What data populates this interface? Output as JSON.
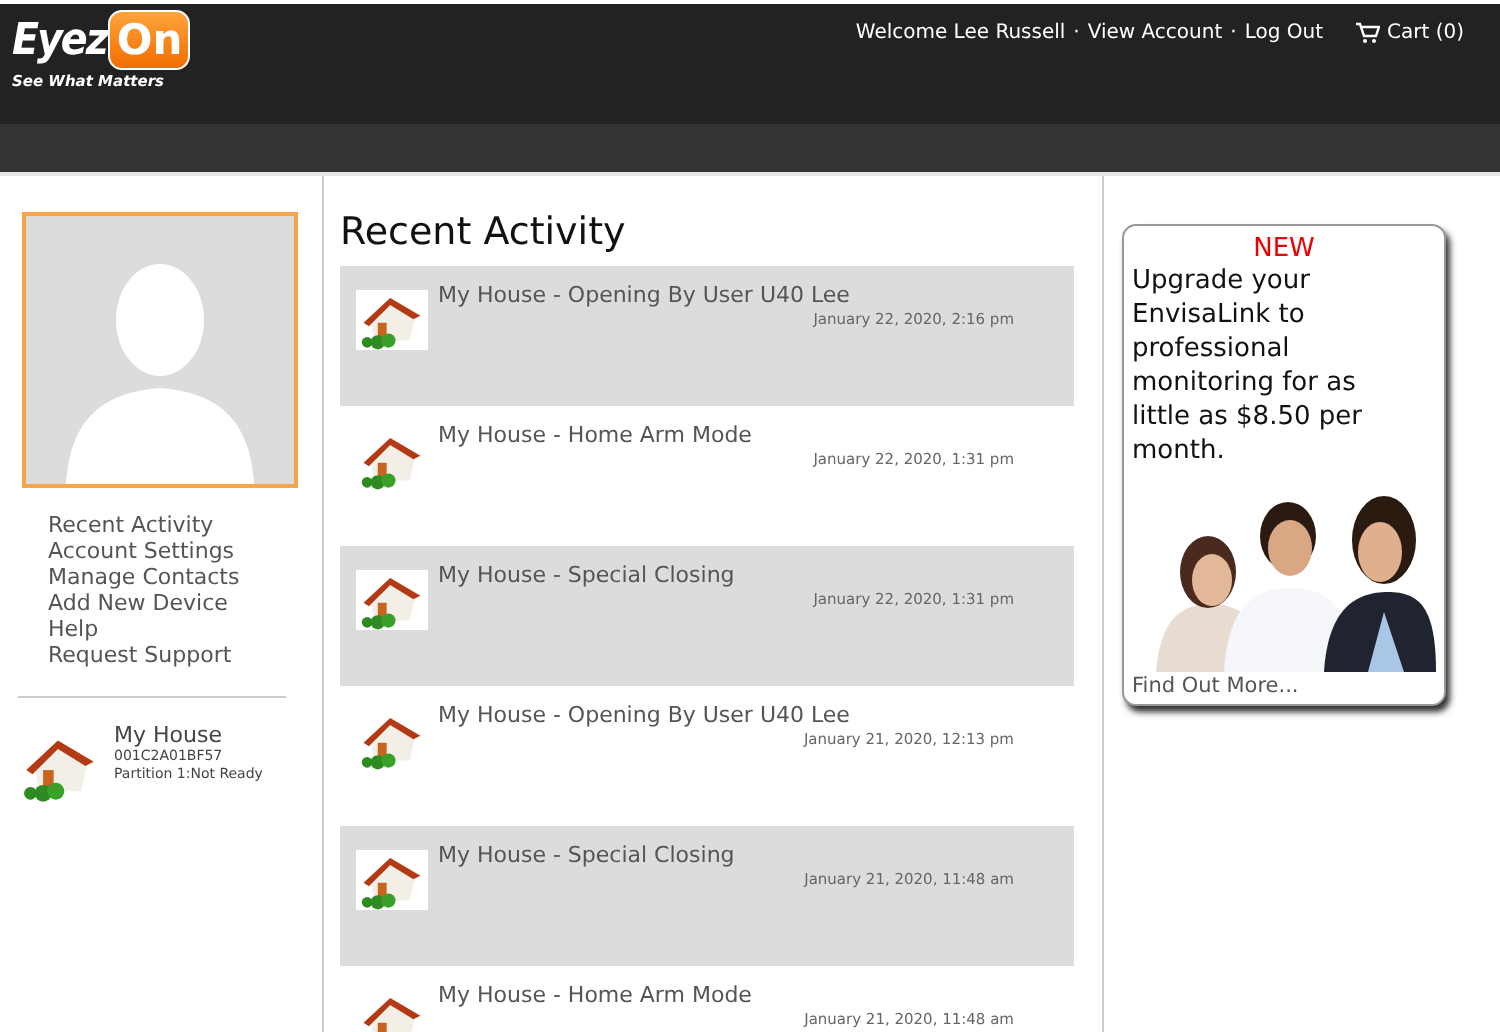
{
  "header": {
    "logo": {
      "word": "Eyez",
      "badge": "On",
      "tagline": "See What Matters"
    },
    "welcome": "Welcome Lee Russell",
    "links": [
      "View Account",
      "Log Out"
    ],
    "separator": "·",
    "cart": "Cart (0)"
  },
  "sidebar": {
    "items": [
      "Recent Activity",
      "Account Settings",
      "Manage Contacts",
      "Add New Device",
      "Help",
      "Request Support"
    ],
    "device": {
      "name": "My House",
      "id": "001C2A01BF57",
      "status": "Partition 1:Not Ready"
    }
  },
  "activity": {
    "title": "Recent Activity",
    "events": [
      {
        "text": "My House - Opening By User U40 Lee",
        "time": "January 22, 2020, 2:16 pm"
      },
      {
        "text": "My House - Home Arm Mode",
        "time": "January 22, 2020, 1:31 pm"
      },
      {
        "text": "My House - Special Closing",
        "time": "January 22, 2020, 1:31 pm"
      },
      {
        "text": "My House - Opening By User U40 Lee",
        "time": "January 21, 2020, 12:13 pm"
      },
      {
        "text": "My House - Special Closing",
        "time": "January 21, 2020, 11:48 am"
      },
      {
        "text": "My House - Home Arm Mode",
        "time": "January 21, 2020, 11:48 am"
      }
    ]
  },
  "promo": {
    "badge": "NEW",
    "text": "Upgrade your EnvisaLink to professional monitoring for as little as $8.50 per month.",
    "link": "Find Out More..."
  }
}
